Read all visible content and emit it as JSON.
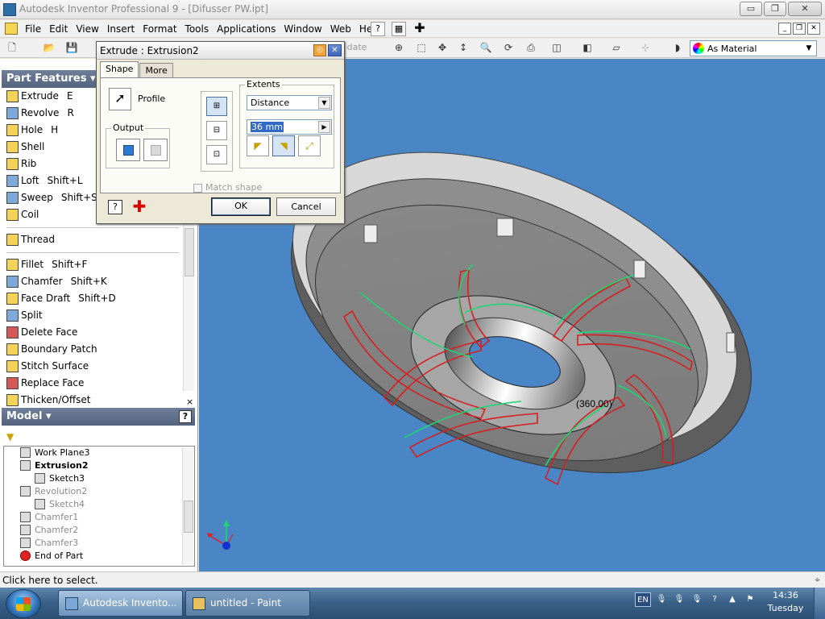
{
  "window": {
    "title": "Autodesk Inventor Professional 9 - [Difusser PW.ipt]",
    "min_label": "▭",
    "restore_label": "❐",
    "close_label": "✕"
  },
  "menu": {
    "items": [
      "File",
      "Edit",
      "View",
      "Insert",
      "Format",
      "Tools",
      "Applications",
      "Window",
      "Web",
      "Help"
    ],
    "mdi": [
      "_",
      "❐",
      "✕"
    ]
  },
  "toolbar": {
    "update_label": "date",
    "material": "As Material"
  },
  "part_features": {
    "header": "Part Features ▾",
    "items": [
      {
        "label": "Extrude",
        "key": "E",
        "icon": "extrude-icon"
      },
      {
        "label": "Revolve",
        "key": "R",
        "icon": "revolve-icon"
      },
      {
        "label": "Hole",
        "key": "H",
        "icon": "hole-icon"
      },
      {
        "label": "Shell",
        "key": "",
        "icon": "shell-icon"
      },
      {
        "label": "Rib",
        "key": "",
        "icon": "rib-icon"
      },
      {
        "label": "Loft",
        "key": "Shift+L",
        "icon": "loft-icon"
      },
      {
        "label": "Sweep",
        "key": "Shift+S",
        "icon": "sweep-icon"
      },
      {
        "label": "Coil",
        "key": "",
        "icon": "coil-icon"
      }
    ],
    "items2": [
      {
        "label": "Thread",
        "key": "",
        "icon": "thread-icon"
      }
    ],
    "items3": [
      {
        "label": "Fillet",
        "key": "Shift+F",
        "icon": "fillet-icon"
      },
      {
        "label": "Chamfer",
        "key": "Shift+K",
        "icon": "chamfer-icon"
      },
      {
        "label": "Face Draft",
        "key": "Shift+D",
        "icon": "face-draft-icon"
      },
      {
        "label": "Split",
        "key": "",
        "icon": "split-icon"
      },
      {
        "label": "Delete Face",
        "key": "",
        "icon": "delete-face-icon"
      },
      {
        "label": "Boundary Patch",
        "key": "",
        "icon": "boundary-patch-icon"
      },
      {
        "label": "Stitch Surface",
        "key": "",
        "icon": "stitch-surface-icon"
      },
      {
        "label": "Replace Face",
        "key": "",
        "icon": "replace-face-icon"
      },
      {
        "label": "Thicken/Offset",
        "key": "",
        "icon": "thicken-icon"
      }
    ],
    "close": "×"
  },
  "model": {
    "header": "Model ▾",
    "help": "?",
    "tree": [
      {
        "label": "Work Plane3",
        "indent": 0,
        "style": "normal",
        "icon": "work-plane-icon"
      },
      {
        "label": "Extrusion2",
        "indent": 0,
        "style": "bold",
        "icon": "extrusion-icon"
      },
      {
        "label": "Sketch3",
        "indent": 1,
        "style": "normal",
        "icon": "sketch-icon"
      },
      {
        "label": "Revolution2",
        "indent": 0,
        "style": "dim",
        "icon": "revolution-icon"
      },
      {
        "label": "Sketch4",
        "indent": 1,
        "style": "dim",
        "icon": "sketch-icon"
      },
      {
        "label": "Chamfer1",
        "indent": 0,
        "style": "dim",
        "icon": "chamfer-icon"
      },
      {
        "label": "Chamfer2",
        "indent": 0,
        "style": "dim",
        "icon": "chamfer-icon"
      },
      {
        "label": "Chamfer3",
        "indent": 0,
        "style": "dim",
        "icon": "chamfer-icon"
      },
      {
        "label": "End of Part",
        "indent": 0,
        "style": "normal",
        "icon": "end-of-part-icon"
      }
    ]
  },
  "dialog": {
    "title": "Extrude : Extrusion2",
    "tabs": [
      "Shape",
      "More"
    ],
    "profile_label": "Profile",
    "output_label": "Output",
    "extents_label": "Extents",
    "extents_type": "Distance",
    "distance": "36 mm",
    "match_shape": "Match shape",
    "ok": "OK",
    "cancel": "Cancel",
    "help": "?"
  },
  "viewport": {
    "dimension_label": "(360.00)",
    "background": "#4a86c5"
  },
  "status": {
    "text": "Click here to select."
  },
  "taskbar": {
    "tasks": [
      "Autodesk Invento...",
      "untitled - Paint"
    ],
    "lang": "EN",
    "time": "14:36",
    "day": "Tuesday"
  }
}
